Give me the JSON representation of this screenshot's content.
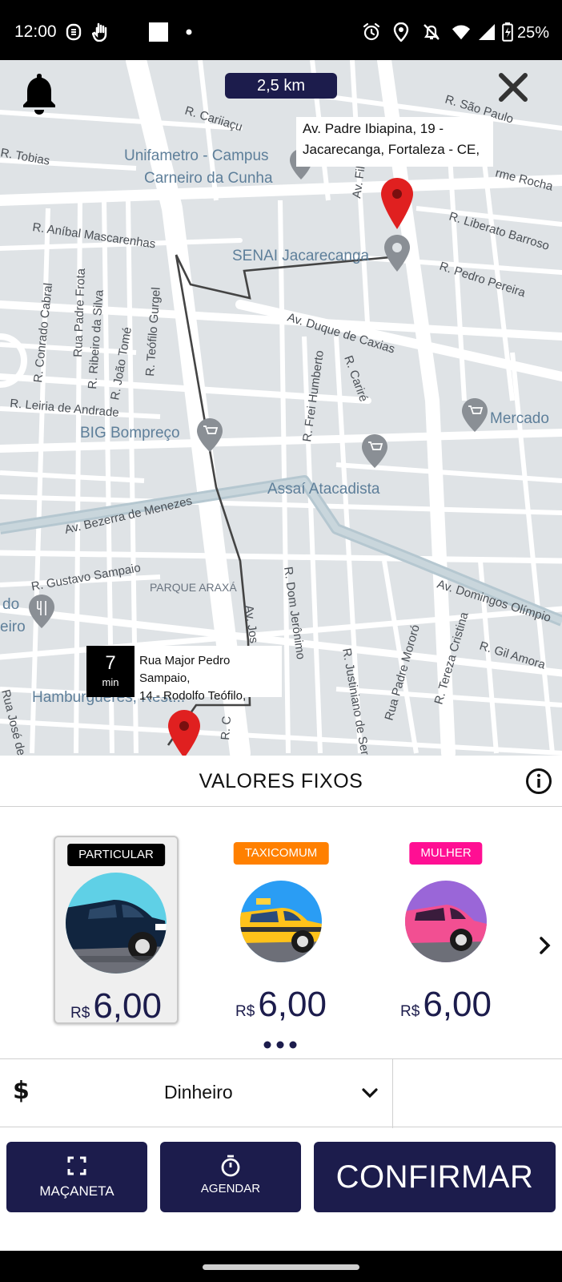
{
  "status_bar": {
    "time": "12:00",
    "battery": "25%",
    "icons": [
      "notification-s-icon",
      "hand-icon",
      "square-icon",
      "dot-icon",
      "alarm-icon",
      "location-icon",
      "mute-icon",
      "wifi-icon",
      "signal-icon",
      "battery-icon"
    ]
  },
  "map": {
    "distance": "2,5 km",
    "destination_address": "Av. Padre Ibiapina, 19 - Jacarecanga, Fortaleza - CE,",
    "destination_address_line1": "Av. Padre Ibiapina, 19 -",
    "destination_address_line2": "Jacarecanga, Fortaleza - CE,",
    "origin_eta_value": "7",
    "origin_eta_unit": "min",
    "origin_address_line1": "Rua Major Pedro Sampaio,",
    "origin_address_line2": "14 - Rodolfo Teófilo,",
    "streets": {
      "cariiacu": "R. Cariiaçu",
      "sao_paulo": "R. São Paulo",
      "tobias": "R. Tobias",
      "rocha": "rme Rocha",
      "anibal": "R. Aníbal Mascarenhas",
      "liberato": "R. Liberato Barroso",
      "pedro_pereira": "R. Pedro Pereira",
      "duque": "Av. Duque de Caxias",
      "conrado": "R. Conrado Cabral",
      "padre_frota": "Rua Padre Frota",
      "ribeiro": "R. Ribeiro da Silva",
      "joao_tome": "R. João Tomé",
      "teofilo": "R. Teófilo Gurgel",
      "frei_humberto": "R. Frei Humberto",
      "cariri": "R. Cariré",
      "leiria": "R. Leiria de Andrade",
      "bezerra": "Av. Bezerra de Menezes",
      "gustavo": "R. Gustavo Sampaio",
      "dom_jeronimo": "R. Dom Jerônimo",
      "justiniano": "R. Justiniano de Ser",
      "padre_mororo": "Rua Padre Mororó",
      "tereza": "R. Tereza Cristina",
      "domingos": "Av. Domingos Olímpio",
      "gil_amora": "R. Gil Amora",
      "av_jos": "Av. Jos",
      "fi": "Av. Fil",
      "jose_de": "Rua José de",
      "r_c": "R. C"
    },
    "pois": {
      "unifametro_1": "Unifametro - Campus",
      "unifametro_2": "Carneiro da Cunha",
      "senai": "SENAI Jacarecanga",
      "mercado": "Mercado",
      "big": "BIG Bompreço",
      "assai": "Assaí Atacadista",
      "parque": "PARQUE ARAXÁ",
      "do": "do",
      "eiro": "eiro",
      "hamb": "Hamburgueres, Rest..."
    }
  },
  "sheet": {
    "title": "VALORES FIXOS",
    "categories": [
      {
        "label": "PARTICULAR",
        "currency": "R$",
        "price": "6,00",
        "color": "#000000",
        "selected": true
      },
      {
        "label": "TAXICOMUM",
        "currency": "R$",
        "price": "6,00",
        "color": "#ff8000",
        "selected": false
      },
      {
        "label": "MULHER",
        "currency": "R$",
        "price": "6,00",
        "color": "#ff0f93",
        "selected": false
      }
    ],
    "payment_method": "Dinheiro",
    "buttons": {
      "handle": "MAÇANETA",
      "schedule": "AGENDAR",
      "confirm": "CONFIRMAR"
    }
  },
  "colors": {
    "primary": "#1c1c4c",
    "pin_red": "#e02020",
    "map_bg": "#dfe3e6",
    "route": "#444444"
  }
}
